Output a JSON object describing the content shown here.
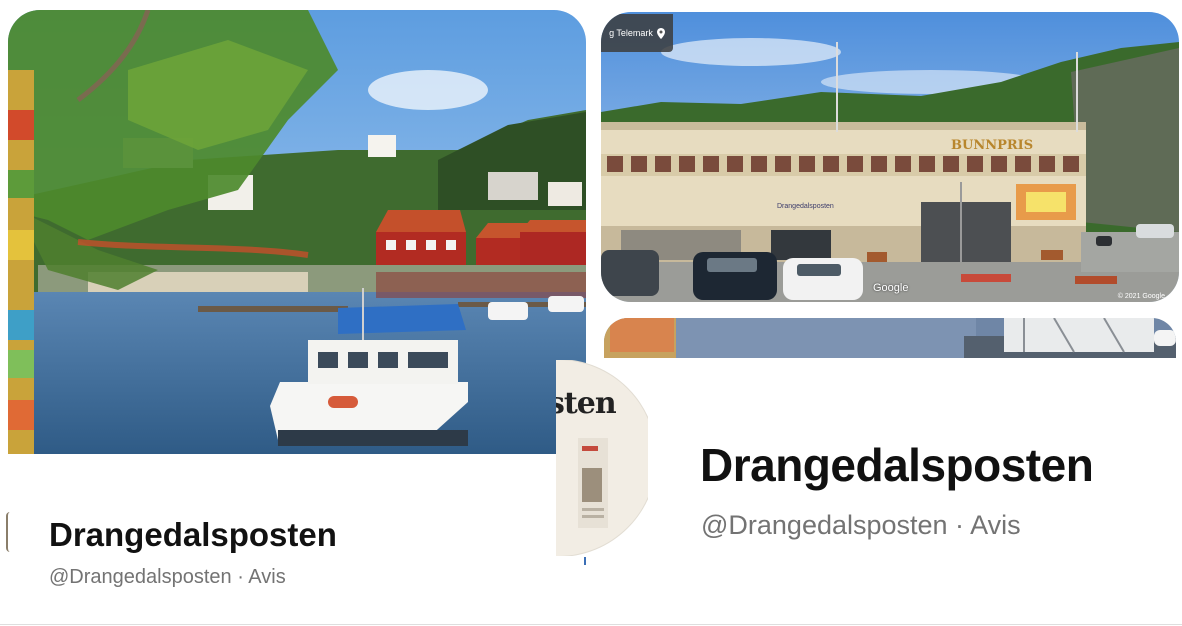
{
  "profile_left": {
    "name": "Drangedalsposten",
    "handle": "@Drangedalsposten",
    "category": "Avis",
    "handle_line": "@Drangedalsposten · Avis"
  },
  "profile_right": {
    "name": "Drangedalsposten",
    "handle": "@Drangedalsposten",
    "category": "Avis",
    "handle_line": "@Drangedalsposten · Avis",
    "avatar_text": "sten"
  },
  "street_view": {
    "location_label": "g Telemark",
    "store_sign": "BUNNPRIS",
    "store_banner": "Drangedalsposten",
    "watermark": "Google",
    "copyright": "© 2021 Google"
  },
  "colors": {
    "name_text": "#111111",
    "handle_text": "#737373",
    "sky": "#6fa8e6",
    "water": "#3d6d9e",
    "boat_canopy": "#2f6fc4"
  }
}
